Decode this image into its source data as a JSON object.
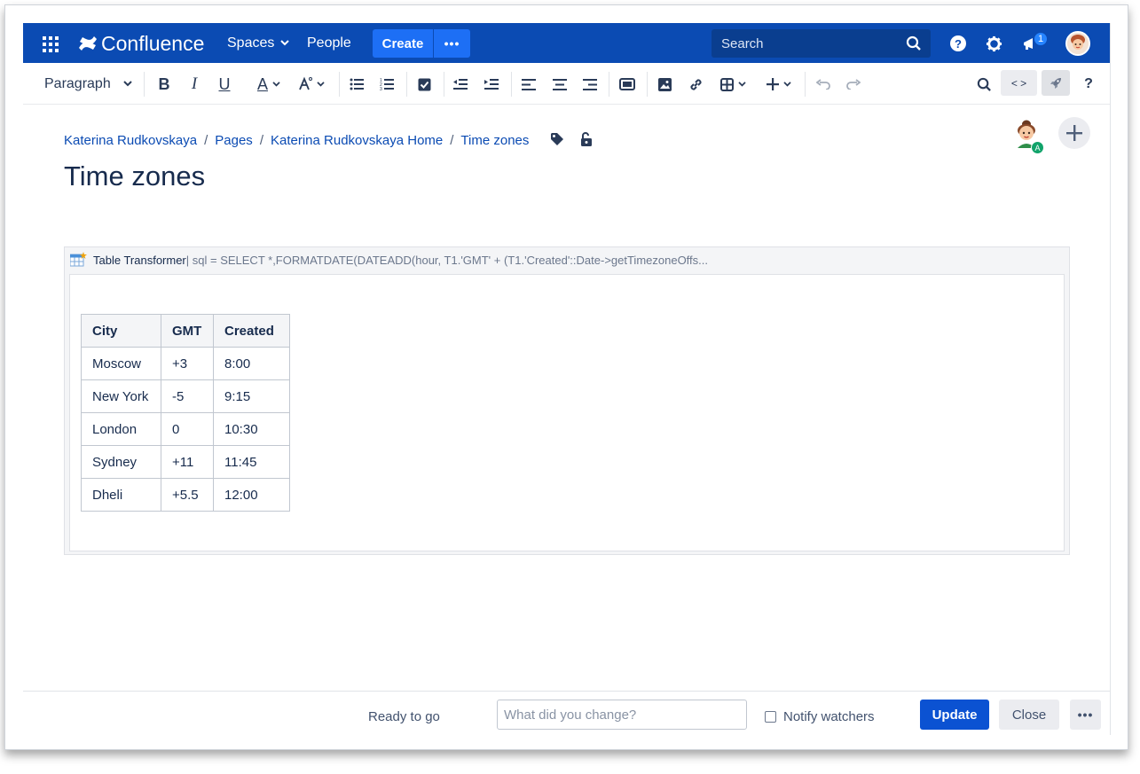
{
  "nav": {
    "logo_text": "Confluence",
    "spaces_label": "Spaces",
    "people_label": "People",
    "create_label": "Create",
    "more_label": "•••",
    "search_placeholder": "Search",
    "notification_count": "1",
    "brand_color": "#0b4bb3"
  },
  "toolbar": {
    "paragraph_label": "Paragraph",
    "bold_label": "B",
    "italic_label": "I",
    "underline_label": "U",
    "text_color_label": "A",
    "code_label": "< >",
    "help_label": "?"
  },
  "breadcrumb": {
    "items": [
      "Katerina Rudkovskaya",
      "Pages",
      "Katerina Rudkovskaya Home",
      "Time zones"
    ]
  },
  "collaborator_badge": "A",
  "page": {
    "title": "Time zones"
  },
  "macro": {
    "name": "Table Transformer",
    "params": " | sql = SELECT *,FORMATDATE(DATEADD(hour, T1.'GMT' + (T1.'Created'::Date->getTimezoneOffs...",
    "table": {
      "headers": [
        "City",
        "GMT",
        "Created"
      ],
      "rows": [
        [
          "Moscow",
          "+3",
          "8:00"
        ],
        [
          "New York",
          "-5",
          "9:15"
        ],
        [
          "London",
          "0",
          "10:30"
        ],
        [
          "Sydney",
          "+11",
          "11:45"
        ],
        [
          "Dheli",
          "+5.5",
          "12:00"
        ]
      ]
    }
  },
  "footer": {
    "status": "Ready to go",
    "change_placeholder": "What did you change?",
    "notify_label": "Notify watchers",
    "update_label": "Update",
    "close_label": "Close",
    "more_label": "•••"
  }
}
